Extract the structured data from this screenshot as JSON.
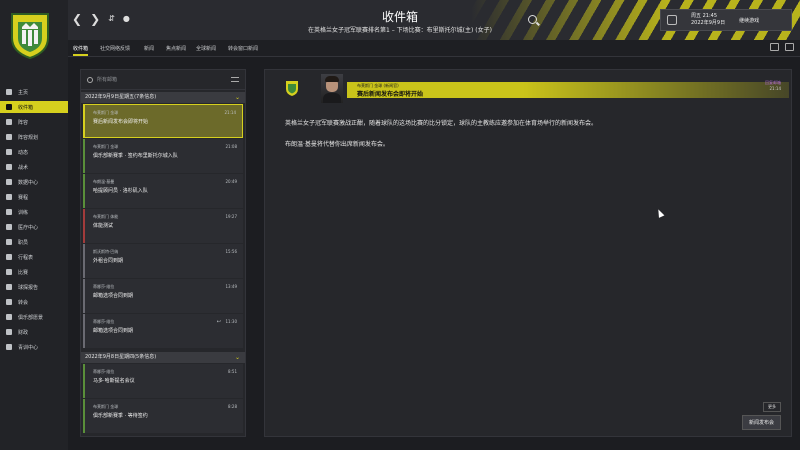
{
  "header": {
    "title": "收件箱",
    "subtitle": "在英格兰女子冠军联赛排名第1 – 下场比赛：布里斯托尔城(主) (女子)",
    "date_line1": "周五 21:45",
    "date_line2": "2022年9月9日",
    "continue_label": "继续游戏"
  },
  "tabs": [
    {
      "label": "收件箱"
    },
    {
      "label": "社交网络反馈"
    },
    {
      "label": "新闻"
    },
    {
      "label": "焦点新闻"
    },
    {
      "label": "全球新闻"
    },
    {
      "label": "转会窗口新闻"
    }
  ],
  "sidebar": {
    "items": [
      {
        "label": "主页"
      },
      {
        "label": "收件箱"
      },
      {
        "label": "阵容"
      },
      {
        "label": "阵容规划"
      },
      {
        "label": "动态"
      },
      {
        "label": "战术"
      },
      {
        "label": "数据中心"
      },
      {
        "label": "赛程"
      },
      {
        "label": "训练"
      },
      {
        "label": "医疗中心"
      },
      {
        "label": "职员"
      },
      {
        "label": "行程表"
      },
      {
        "label": "比赛"
      },
      {
        "label": "球探报告"
      },
      {
        "label": "转会"
      },
      {
        "label": "俱乐部愿景"
      },
      {
        "label": "财政"
      },
      {
        "label": "青训中心"
      }
    ]
  },
  "list": {
    "search_placeholder": "所有邮箱",
    "groups": [
      {
        "label": "2022年9月9日星期五(7条信息)",
        "messages": [
          {
            "sender": "布莱斯门 金球",
            "subject": "赛后新闻发布会即将开始",
            "time": "21:14",
            "reply": ""
          },
          {
            "sender": "布莱斯门 金球",
            "subject": "俱乐部新赛季 · 签约布里斯托尔城入队",
            "time": "21:08",
            "reply": ""
          },
          {
            "sender": "布朗温·基曼",
            "subject": "哈提顾问员 · 洛杉矶入队",
            "time": "20:49",
            "reply": ""
          },
          {
            "sender": "布莱斯门 体能",
            "subject": "体能测试",
            "time": "19:27",
            "reply": ""
          },
          {
            "sender": "斯沃斯特·巴纳",
            "subject": "外租合同到期",
            "time": "15:56",
            "reply": ""
          },
          {
            "sender": "蒂娜莎·维拉",
            "subject": "邮箱选项合同到期",
            "time": "13:49",
            "reply": ""
          },
          {
            "sender": "蒂娜莎·维拉",
            "subject": "邮箱选项合同到期",
            "time": "11:30",
            "reply": "↩"
          }
        ]
      },
      {
        "label": "2022年9月8日星期四(5条信息)",
        "messages": [
          {
            "sender": "蒂娜莎·维拉",
            "subject": "马多·哈斯提名会议",
            "time": "8:51",
            "reply": ""
          },
          {
            "sender": "布莱斯门 金球",
            "subject": "俱乐部新赛季 · 等待签约",
            "time": "8:28",
            "reply": ""
          }
        ]
      }
    ]
  },
  "reader": {
    "from": "布莱斯门 金球 (新闻官)",
    "subject": "赛后新闻发布会即将开始",
    "reply_label": "回复邮箱",
    "time": "21:14",
    "paragraphs": [
      "英格兰女子冠军联赛激战正酣，随着球队的这场比赛的比分锁定，球队的主教练应邀参加在体育场举行的新闻发布会。",
      "布朗温·基曼将代替你出席新闻发布会。"
    ],
    "more_label": "更多",
    "action_label": "新闻发布会"
  },
  "colors": {
    "accent": "#d6d01e",
    "sidebar_bg": "#222327",
    "panel_bg": "#26272b"
  }
}
